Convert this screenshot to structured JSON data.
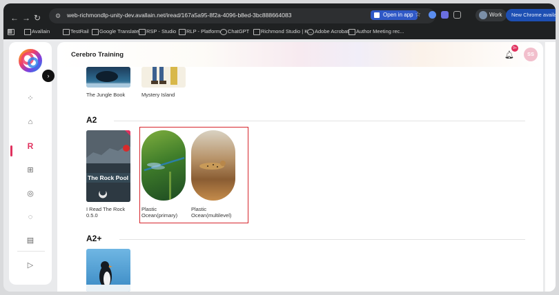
{
  "browser": {
    "url": "web-richmondlp-unity-dev.avallain.net/iread/167a5a95-8f2a-4096-b8ed-3bc888664083",
    "open_in_app": "Open in app",
    "profile": "Work",
    "new_chrome": "New Chrome available",
    "bookmarks": [
      "Avallain",
      "TestRail",
      "Google Translate",
      "RSP - Studio",
      "RLP - Platform",
      "ChatGPT",
      "Richmond Studio | K...",
      "Adobe Acrobat",
      "Author Meeting rec..."
    ]
  },
  "header": {
    "title": "Cerebro Training",
    "notifications_badge": "9+",
    "avatar_initials": "SS"
  },
  "sections": {
    "top_books": [
      {
        "title": "The Jungle Book"
      },
      {
        "title": "Mystery Island"
      }
    ],
    "a2": {
      "label": "A2",
      "books": [
        {
          "title": "I Read The Rock\n0.5.0",
          "cover_text": "The Rock Pool"
        },
        {
          "title": "Plastic\nOcean(primary)"
        },
        {
          "title": "Plastic\nOcean(multilevel)"
        }
      ]
    },
    "a2plus": {
      "label": "A2+"
    }
  },
  "colors": {
    "accent": "#e0315e",
    "highlight": "#d6232a"
  }
}
